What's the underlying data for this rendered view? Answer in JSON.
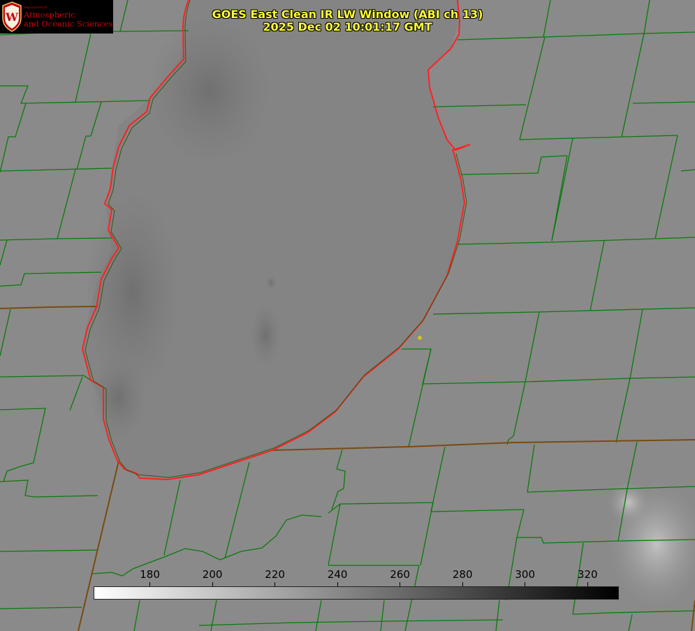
{
  "title": {
    "line1": "GOES East Clean IR LW Window (ABI ch 13)",
    "line2": "2025 Dec 02 10:01:17 GMT"
  },
  "logo": {
    "department": "Department of",
    "line1": "Atmospheric",
    "line2": "and Oceanic Sciences",
    "crest_letter": "W"
  },
  "colorbar": {
    "min": 162,
    "max": 330,
    "start_color": "#ffffff",
    "end_color": "#000000",
    "ticks": [
      {
        "value": 180,
        "label": "180"
      },
      {
        "value": 200,
        "label": "200"
      },
      {
        "value": 220,
        "label": "220"
      },
      {
        "value": 240,
        "label": "240"
      },
      {
        "value": 260,
        "label": "260"
      },
      {
        "value": 280,
        "label": "280"
      },
      {
        "value": 300,
        "label": "300"
      },
      {
        "value": 320,
        "label": "320"
      }
    ]
  },
  "colors": {
    "background_gray": "#8a8a8a",
    "lake_gray": "#848484",
    "county_lines": "#0a7a0a",
    "state_lines": "#7a4a10",
    "coastline": "#ff2020",
    "title_text": "#ffff33",
    "brand_red": "#c5050c",
    "marker": "#d4c020"
  }
}
